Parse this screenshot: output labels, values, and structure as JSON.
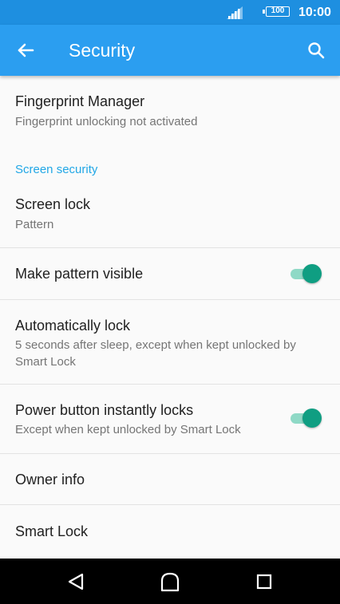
{
  "status_bar": {
    "battery": "100",
    "time": "10:00",
    "icons": [
      "signal-icon",
      "battery-icon"
    ]
  },
  "app_bar": {
    "title": "Security",
    "back_icon": "arrow-back-icon",
    "search_icon": "search-icon"
  },
  "items": {
    "fingerprint": {
      "primary": "Fingerprint Manager",
      "secondary": "Fingerprint unlocking not activated"
    },
    "section_screen_security": "Screen security",
    "screen_lock": {
      "primary": "Screen lock",
      "secondary": "Pattern"
    },
    "make_pattern_visible": {
      "primary": "Make pattern visible",
      "toggle_on": true
    },
    "automatically_lock": {
      "primary": "Automatically lock",
      "secondary": "5 seconds after sleep, except when kept unlocked by Smart Lock"
    },
    "power_button_locks": {
      "primary": "Power button instantly locks",
      "secondary": "Except when kept unlocked by Smart Lock",
      "toggle_on": true
    },
    "owner_info": {
      "primary": "Owner info"
    },
    "smart_lock": {
      "primary": "Smart Lock"
    }
  },
  "nav_bar": {
    "icons": [
      "back-triangle-icon",
      "home-icon",
      "recents-square-icon"
    ]
  },
  "colors": {
    "status_bar": "#1e8fe0",
    "app_bar": "#2b9ef0",
    "accent": "#21a7e6",
    "toggle_thumb": "#0f9e82",
    "toggle_track": "#8fd9c6"
  }
}
